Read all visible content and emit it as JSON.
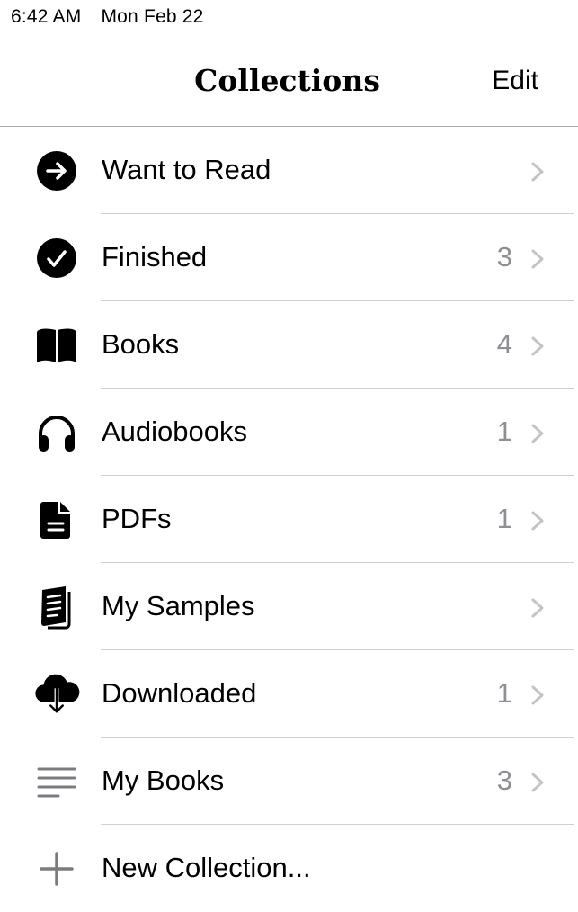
{
  "status_bar": {
    "time": "6:42 AM",
    "date": "Mon Feb 22"
  },
  "nav": {
    "title": "Collections",
    "edit_label": "Edit"
  },
  "collections": [
    {
      "label": "Want to Read",
      "count": "",
      "icon": "arrow-right-circle-icon"
    },
    {
      "label": "Finished",
      "count": "3",
      "icon": "checkmark-circle-icon"
    },
    {
      "label": "Books",
      "count": "4",
      "icon": "book-icon"
    },
    {
      "label": "Audiobooks",
      "count": "1",
      "icon": "headphones-icon"
    },
    {
      "label": "PDFs",
      "count": "1",
      "icon": "document-icon"
    },
    {
      "label": "My Samples",
      "count": "",
      "icon": "samples-icon"
    },
    {
      "label": "Downloaded",
      "count": "1",
      "icon": "cloud-download-icon"
    },
    {
      "label": "My Books",
      "count": "3",
      "icon": "list-lines-icon"
    }
  ],
  "new_collection": {
    "label": "New Collection...",
    "icon": "plus-icon"
  }
}
